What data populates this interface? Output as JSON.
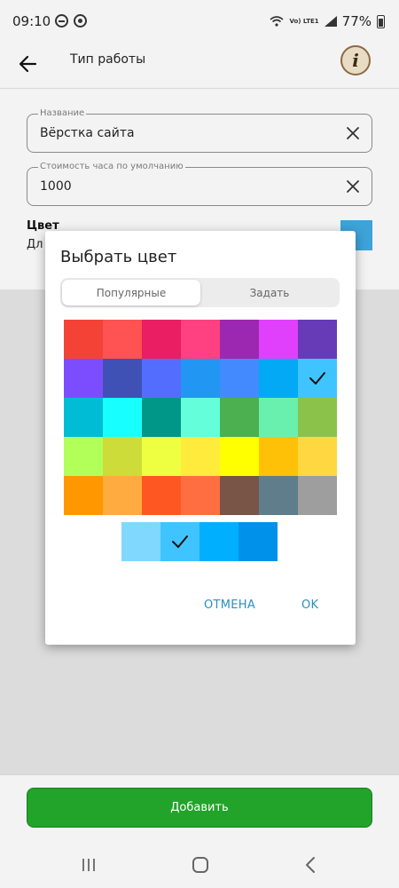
{
  "status_bar": {
    "time": "09:10",
    "battery": "77%",
    "network": "Vo) LTE1"
  },
  "app_bar": {
    "title": "Тип работы",
    "info_letter": "i"
  },
  "form": {
    "name_label": "Название",
    "name_value": "Вёрстка сайта",
    "price_label": "Стоимость часа по умолчанию",
    "price_value": "1000",
    "color_label": "Цвет",
    "color_sub": "Дл",
    "color_value": "#3da3d8"
  },
  "dialog": {
    "title": "Выбрать цвет",
    "tabs": [
      {
        "label": "Популярные",
        "active": true
      },
      {
        "label": "Задать",
        "active": false
      }
    ],
    "palette": [
      "#f44336",
      "#ff5252",
      "#e91e63",
      "#ff4081",
      "#9c27b0",
      "#e040fb",
      "#673ab7",
      "#7c4dff",
      "#3f51b5",
      "#536dfe",
      "#2196f3",
      "#448aff",
      "#03a9f4",
      "#40c4ff",
      "#00bcd4",
      "#18ffff",
      "#009688",
      "#64ffda",
      "#4caf50",
      "#69f0ae",
      "#8bc34a",
      "#b2ff59",
      "#cddc39",
      "#eeff41",
      "#ffeb3b",
      "#ffff00",
      "#ffc107",
      "#ffd740",
      "#ff9800",
      "#ffab40",
      "#ff5722",
      "#ff6e40",
      "#795548",
      "#607d8b",
      "#9e9e9e"
    ],
    "palette_selected_index": 13,
    "shades": [
      "#80d8ff",
      "#40c4ff",
      "#00b0ff",
      "#0091ea"
    ],
    "shades_selected_index": 1,
    "cancel_label": "ОТМЕНА",
    "ok_label": "OK",
    "accent_color": "#2b8fbf"
  },
  "add_button_label": "Добавить",
  "nav_bar": {
    "recents": "recents-icon",
    "home": "home-icon",
    "back": "back-icon"
  }
}
